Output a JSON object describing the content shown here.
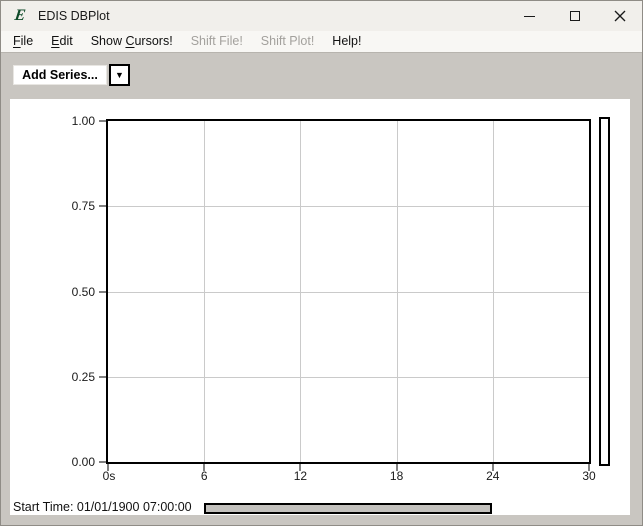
{
  "window": {
    "title": "EDIS DBPlot",
    "icons": {
      "app_logo": "E",
      "dropdown": "▼"
    }
  },
  "menu": {
    "items": [
      {
        "pre": "",
        "key": "F",
        "post": "ile",
        "enabled": true
      },
      {
        "pre": "",
        "key": "E",
        "post": "dit",
        "enabled": true
      },
      {
        "pre": "Show ",
        "key": "C",
        "post": "ursors!",
        "enabled": true
      },
      {
        "pre": "Shift File!",
        "key": "",
        "post": "",
        "enabled": false
      },
      {
        "pre": "Shift Plot!",
        "key": "",
        "post": "",
        "enabled": false
      },
      {
        "pre": "Help!",
        "key": "",
        "post": "",
        "enabled": true
      }
    ]
  },
  "toolbar": {
    "add_series_label": "Add Series..."
  },
  "chart_data": {
    "type": "line",
    "title": "",
    "series": [],
    "x_ticks": [
      "0s",
      "6",
      "12",
      "18",
      "24",
      "30"
    ],
    "y_ticks_top_to_bottom": [
      "1.00",
      "0.75",
      "0.50",
      "0.25",
      "0.00"
    ],
    "x_range": [
      0,
      30
    ],
    "y_range": [
      0.0,
      1.0
    ],
    "x_unit": "s",
    "grid": true,
    "legend": false,
    "plot_empty": true
  },
  "statusbar": {
    "start_time": "Start Time: 01/01/1900 07:00:00"
  }
}
